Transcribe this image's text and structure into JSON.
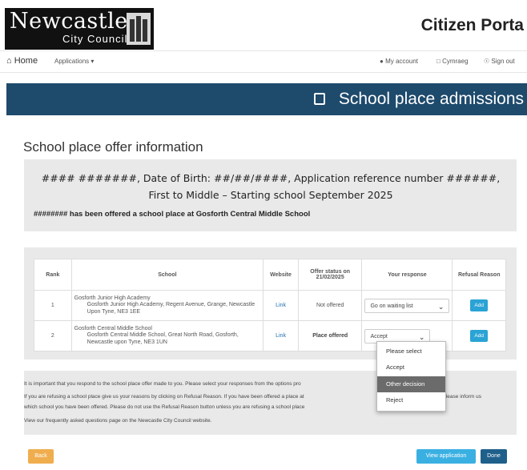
{
  "header": {
    "logo_line1": "Newcastle",
    "logo_line2": "City Council",
    "portal_title": "Citizen Porta"
  },
  "nav": {
    "home": "Home",
    "applications": "Applications",
    "my_account": "My account",
    "cymraeg": "Cymraeg",
    "sign_out": "Sign out"
  },
  "banner": {
    "title": "School place admissions"
  },
  "page_title": "School place offer information",
  "info": {
    "summary": "#### #######, Date of Birth: ##/##/####, Application reference number ######, First to Middle – Starting school September 2025",
    "offer_line": "######## has been offered a school place at Gosforth Central Middle School"
  },
  "table": {
    "headers": {
      "rank": "Rank",
      "school": "School",
      "website": "Website",
      "offer_status": "Offer status on 21/02/2025",
      "response": "Your response",
      "refusal": "Refusal Reason"
    },
    "rows": [
      {
        "rank": "1",
        "school_name": "Gosforth Junior High Academy",
        "school_address": "Gosforth Junior High Academy, Regent Avenue, Grange, Newcastle Upon Tyne, NE3 1EE",
        "website": "Link",
        "status": "Not offered",
        "response": "Go on waiting list",
        "add": "Add"
      },
      {
        "rank": "2",
        "school_name": "Gosforth Central Middle School",
        "school_address": "Gosforth Central Middle School, Great North Road, Gosforth, Newcastle upon Tyne, NE3 1UN",
        "website": "Link",
        "status": "Place offered",
        "response": "Accept",
        "add": "Add"
      }
    ]
  },
  "dropdown": {
    "options": [
      "Please select",
      "Accept",
      "Other decision",
      "Reject"
    ],
    "highlighted": "Other decision"
  },
  "notes": {
    "n1": "It is important that you respond to the school place offer made to you. Please select your responses from the options pro",
    "n2a": "If you are refusing a school place give us your reasons by clicking on Refusal Reason. If you have been offered a place at",
    "n2b": "l please inform us",
    "n3": "which school you have been offered. Please do not use the Refusal Reason button unless you are refusing a school place",
    "n4": "View our frequently asked questions page on the Newcastle City Council website."
  },
  "buttons": {
    "back": "Back",
    "view_application": "View application",
    "done": "Done"
  },
  "colors": {
    "banner": "#1e4a6c",
    "add_button": "#2aa3d5",
    "back_button": "#f0ad4e",
    "done_button": "#1f5f8b"
  }
}
